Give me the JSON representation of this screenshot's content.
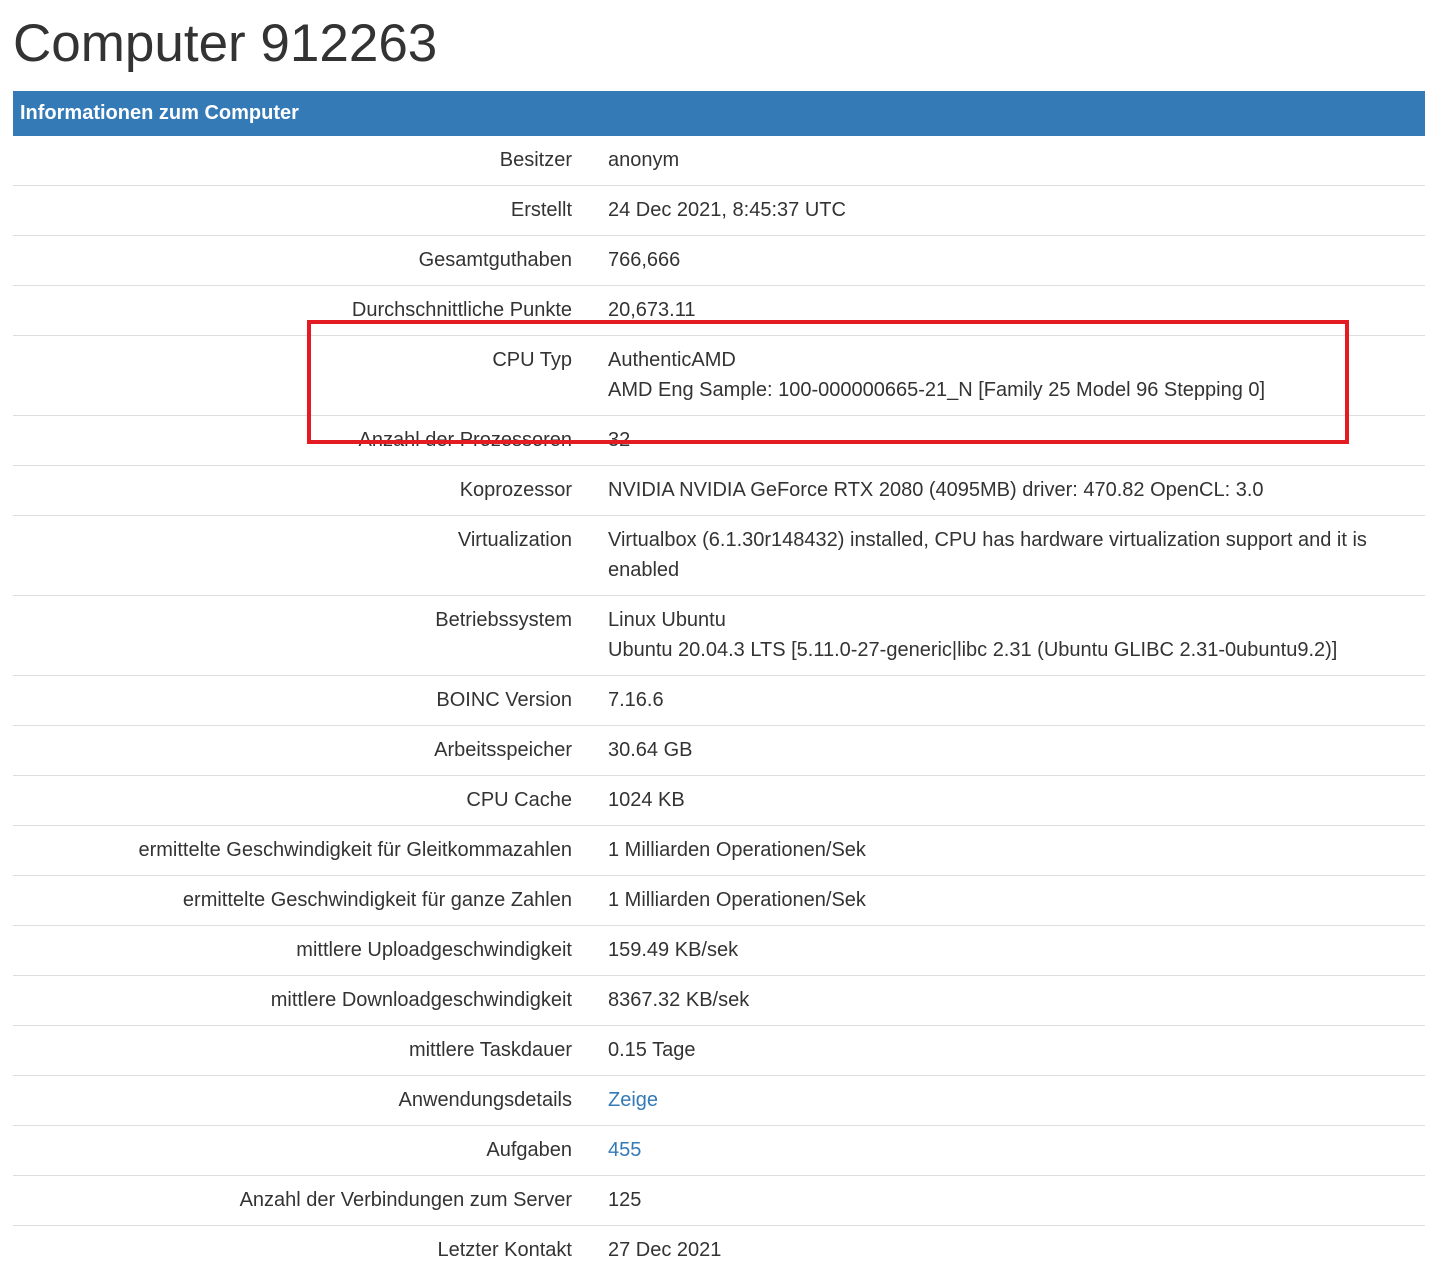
{
  "page": {
    "title": "Computer 912263"
  },
  "panel": {
    "header": "Informationen zum Computer"
  },
  "rows": [
    {
      "label": "Besitzer",
      "lines": [
        "anonym"
      ]
    },
    {
      "label": "Erstellt",
      "lines": [
        "24 Dec 2021, 8:45:37 UTC"
      ]
    },
    {
      "label": "Gesamtguthaben",
      "lines": [
        "766,666"
      ]
    },
    {
      "label": "Durchschnittliche Punkte",
      "lines": [
        "20,673.11"
      ]
    },
    {
      "label": "CPU Typ",
      "lines": [
        "AuthenticAMD",
        "AMD Eng Sample: 100-000000665-21_N [Family 25 Model 96 Stepping 0]"
      ]
    },
    {
      "label": "Anzahl der Prozessoren",
      "lines": [
        "32"
      ]
    },
    {
      "label": "Koprozessor",
      "lines": [
        "NVIDIA NVIDIA GeForce RTX 2080 (4095MB) driver: 470.82 OpenCL: 3.0"
      ]
    },
    {
      "label": "Virtualization",
      "lines": [
        "Virtualbox (6.1.30r148432) installed, CPU has hardware virtualization support and it is enabled"
      ]
    },
    {
      "label": "Betriebssystem",
      "lines": [
        "Linux Ubuntu",
        "Ubuntu 20.04.3 LTS [5.11.0-27-generic|libc 2.31 (Ubuntu GLIBC 2.31-0ubuntu9.2)]"
      ]
    },
    {
      "label": "BOINC Version",
      "lines": [
        "7.16.6"
      ]
    },
    {
      "label": "Arbeitsspeicher",
      "lines": [
        "30.64 GB"
      ]
    },
    {
      "label": "CPU Cache",
      "lines": [
        "1024 KB"
      ]
    },
    {
      "label": "ermittelte Geschwindigkeit für Gleitkommazahlen",
      "lines": [
        "1 Milliarden Operationen/Sek"
      ]
    },
    {
      "label": "ermittelte Geschwindigkeit für ganze Zahlen",
      "lines": [
        "1 Milliarden Operationen/Sek"
      ]
    },
    {
      "label": "mittlere Uploadgeschwindigkeit",
      "lines": [
        "159.49 KB/sek"
      ]
    },
    {
      "label": "mittlere Downloadgeschwindigkeit",
      "lines": [
        "8367.32 KB/sek"
      ]
    },
    {
      "label": "mittlere Taskdauer",
      "lines": [
        "0.15 Tage"
      ]
    },
    {
      "label": "Anwendungsdetails",
      "link": "Zeige"
    },
    {
      "label": "Aufgaben",
      "link": "455"
    },
    {
      "label": "Anzahl der Verbindungen zum Server",
      "lines": [
        "125"
      ]
    },
    {
      "label": "Letzter Kontakt",
      "lines": [
        "27 Dec 2021"
      ]
    }
  ],
  "colors": {
    "header_bg": "#337ab7",
    "link": "#337ab7",
    "highlight": "#e31b23"
  }
}
